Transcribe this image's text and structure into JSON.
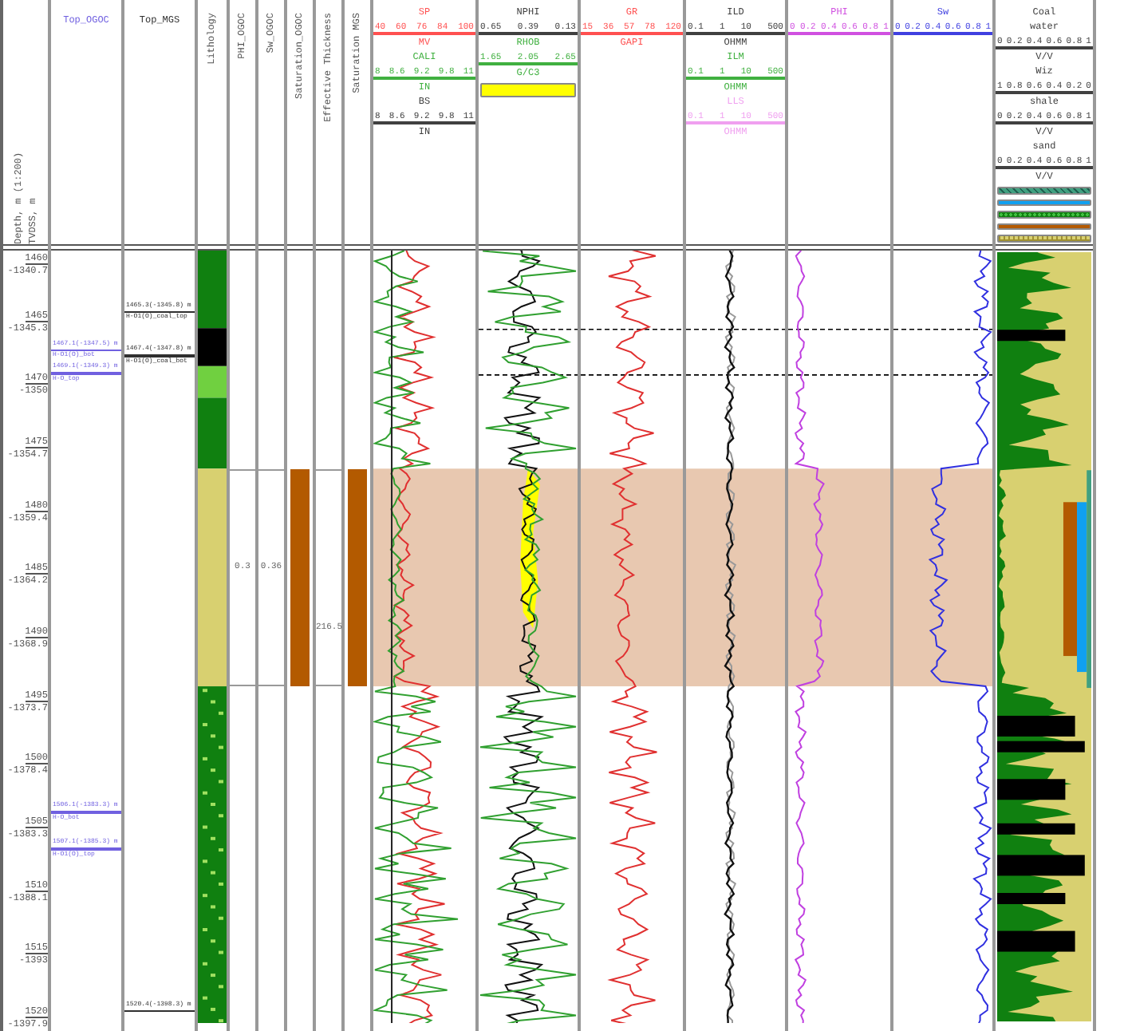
{
  "depth_column": {
    "header": [
      "Depth, m (1:200)",
      "TVDSS, m"
    ],
    "ticks": [
      {
        "md": "1460",
        "tvdss": "-1340.7"
      },
      {
        "md": "1465",
        "tvdss": "-1345.3"
      },
      {
        "md": "1470",
        "tvdss": "-1350"
      },
      {
        "md": "1475",
        "tvdss": "-1354.7"
      },
      {
        "md": "1480",
        "tvdss": "-1359.4"
      },
      {
        "md": "1485",
        "tvdss": "-1364.2"
      },
      {
        "md": "1490",
        "tvdss": "-1368.9"
      },
      {
        "md": "1495",
        "tvdss": "-1373.7"
      },
      {
        "md": "1500",
        "tvdss": "-1378.4"
      },
      {
        "md": "1505",
        "tvdss": "-1383.3"
      },
      {
        "md": "1510",
        "tvdss": "-1388.1"
      },
      {
        "md": "1515",
        "tvdss": "-1393"
      },
      {
        "md": "1520",
        "tvdss": "-1397.9"
      }
    ]
  },
  "marker_columns": [
    {
      "title": "Top_OGOC",
      "color": "#7060e0",
      "markers": [
        {
          "top": "1467.1(-1347.5) m",
          "bottom": "H-O1(O)_bot"
        },
        {
          "top": "1469.1(-1349.3) m",
          "bottom": "H-O_top"
        },
        {
          "top": "1506.1(-1383.3) m",
          "bottom": "H-O_bot"
        },
        {
          "top": "1507.1(-1385.3) m",
          "bottom": "H-O1(O)_top"
        }
      ]
    },
    {
      "title": "Top_MGS",
      "color": "#303030",
      "markers": [
        {
          "top": "1465.3(-1345.8) m",
          "bottom": "H-O1(O)_coal_top"
        },
        {
          "top": "1467.4(-1347.8) m",
          "bottom": "H-O1(O)_coal_bot"
        },
        {
          "top": "1520.4(-1398.3) m"
        }
      ]
    }
  ],
  "result_columns": [
    {
      "title": "Lithology",
      "kind": "lithology"
    },
    {
      "title": "PHI_OGOC",
      "kind": "value",
      "value": "0.3"
    },
    {
      "title": "Sw_OGOC",
      "kind": "value",
      "value": "0.36"
    },
    {
      "title": "Saturation_OGOC",
      "kind": "flag",
      "color": "#b35a00"
    },
    {
      "title": "Effective Thickness",
      "kind": "value",
      "value": "216.5"
    },
    {
      "title": "Saturation MGS",
      "kind": "flag",
      "color": "#b35a00"
    }
  ],
  "tracks": [
    {
      "kind": "sp",
      "header": [
        {
          "kind": "label",
          "text": "SP",
          "color": "#ff5050"
        },
        {
          "kind": "scale",
          "ticks": [
            "40",
            "60",
            "76",
            "84",
            "100"
          ],
          "color": "#ff5050"
        },
        {
          "kind": "label",
          "text": "MV",
          "color": "#ff5050"
        },
        {
          "kind": "label",
          "text": "CALI",
          "color": "#40b040"
        },
        {
          "kind": "scale",
          "ticks": [
            "8",
            "8.6",
            "9.2",
            "9.8",
            "11"
          ],
          "color": "#40b040"
        },
        {
          "kind": "label",
          "text": "IN",
          "color": "#40b040"
        },
        {
          "kind": "label",
          "text": "BS",
          "color": "#404040"
        },
        {
          "kind": "scale",
          "ticks": [
            "8",
            "8.6",
            "9.2",
            "9.8",
            "11"
          ],
          "color": "#404040"
        },
        {
          "kind": "label",
          "text": "IN",
          "color": "#404040"
        }
      ]
    },
    {
      "kind": "nphi",
      "header": [
        {
          "kind": "label",
          "text": "NPHI",
          "color": "#404040"
        },
        {
          "kind": "scale",
          "ticks": [
            "0.65",
            "0.39",
            "0.13"
          ],
          "color": "#404040"
        },
        {
          "kind": "label",
          "text": "RHOB",
          "color": "#40b040"
        },
        {
          "kind": "scale",
          "ticks": [
            "1.65",
            "2.05",
            "2.65"
          ],
          "color": "#40b040"
        },
        {
          "kind": "label",
          "text": "G/C3",
          "color": "#40b040"
        },
        {
          "kind": "swatch",
          "color": "#ffff00"
        }
      ]
    },
    {
      "kind": "gr",
      "header": [
        {
          "kind": "label",
          "text": "GR",
          "color": "#ff5050"
        },
        {
          "kind": "scale",
          "ticks": [
            "15",
            "36",
            "57",
            "78",
            "120"
          ],
          "color": "#ff5050"
        },
        {
          "kind": "label",
          "text": "GAPI",
          "color": "#ff5050"
        }
      ]
    },
    {
      "kind": "res",
      "header": [
        {
          "kind": "label",
          "text": "ILD",
          "color": "#404040"
        },
        {
          "kind": "scale",
          "ticks": [
            "0.1",
            "1",
            "10",
            "500"
          ],
          "color": "#404040"
        },
        {
          "kind": "label",
          "text": "OHMM",
          "color": "#404040"
        },
        {
          "kind": "label",
          "text": "ILM",
          "color": "#40b040"
        },
        {
          "kind": "scale",
          "ticks": [
            "0.1",
            "1",
            "10",
            "500"
          ],
          "color": "#40b040"
        },
        {
          "kind": "label",
          "text": "OHMM",
          "color": "#40b040"
        },
        {
          "kind": "label",
          "text": "LLS",
          "color": "#f0a0f0"
        },
        {
          "kind": "scale",
          "ticks": [
            "0.1",
            "1",
            "10",
            "500"
          ],
          "color": "#f0a0f0"
        },
        {
          "kind": "label",
          "text": "OHMM",
          "color": "#f0a0f0"
        }
      ]
    },
    {
      "kind": "phi",
      "header": [
        {
          "kind": "label",
          "text": "PHI",
          "color": "#d050e0"
        },
        {
          "kind": "scale",
          "ticks": [
            "0",
            "0.2",
            "0.4",
            "0.6",
            "0.8",
            "1"
          ],
          "color": "#d050e0"
        }
      ]
    },
    {
      "kind": "sw",
      "header": [
        {
          "kind": "label",
          "text": "Sw",
          "color": "#4040e0"
        },
        {
          "kind": "scale",
          "ticks": [
            "0",
            "0.2",
            "0.4",
            "0.6",
            "0.8",
            "1"
          ],
          "color": "#4040e0"
        }
      ]
    },
    {
      "kind": "frac",
      "header": [
        {
          "kind": "label",
          "text": "Coal",
          "color": "#404040"
        },
        {
          "kind": "label",
          "text": "water",
          "color": "#404040"
        },
        {
          "kind": "scale",
          "ticks": [
            "0",
            "0.2",
            "0.4",
            "0.6",
            "0.8",
            "1"
          ],
          "color": "#404040"
        },
        {
          "kind": "label",
          "text": "V/V",
          "color": "#404040"
        },
        {
          "kind": "label",
          "text": "Wiz",
          "color": "#404040"
        },
        {
          "kind": "scale",
          "ticks": [
            "1",
            "0.8",
            "0.6",
            "0.4",
            "0.2",
            "0"
          ],
          "color": "#404040"
        },
        {
          "kind": "label",
          "text": "shale",
          "color": "#404040"
        },
        {
          "kind": "scale",
          "ticks": [
            "0",
            "0.2",
            "0.4",
            "0.6",
            "0.8",
            "1"
          ],
          "color": "#404040"
        },
        {
          "kind": "label",
          "text": "V/V",
          "color": "#404040"
        },
        {
          "kind": "label",
          "text": "sand",
          "color": "#404040"
        },
        {
          "kind": "scale",
          "ticks": [
            "0",
            "0.2",
            "0.4",
            "0.6",
            "0.8",
            "1"
          ],
          "color": "#404040"
        },
        {
          "kind": "label",
          "text": "V/V",
          "color": "#404040"
        },
        {
          "kind": "hatch_swatch",
          "color": "#40a080"
        },
        {
          "kind": "swatch",
          "color": "#10a0f0"
        },
        {
          "kind": "dots_swatch",
          "color": "#108010"
        },
        {
          "kind": "swatch",
          "color": "#b35a00"
        },
        {
          "kind": "grid_swatch",
          "color": "#d8d070"
        }
      ]
    }
  ]
}
